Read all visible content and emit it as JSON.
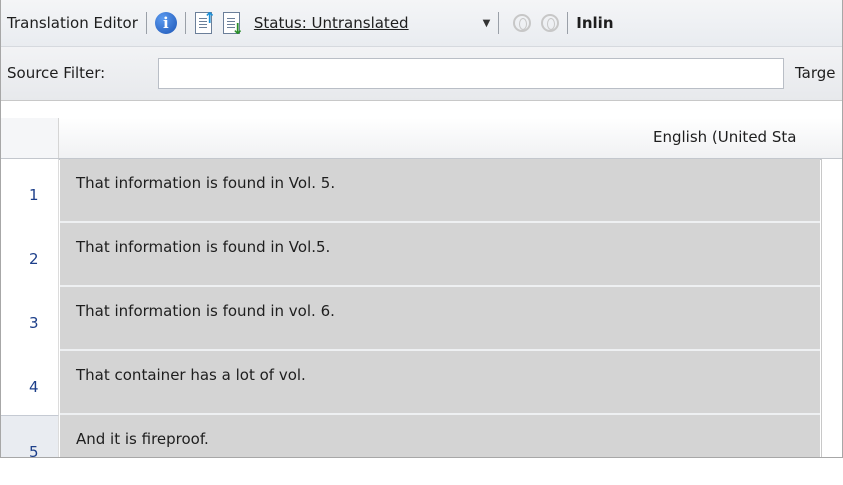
{
  "toolbar": {
    "title": "Translation Editor",
    "status_label": "Status: Untranslated",
    "inline_label": "Inlin",
    "icons": [
      "info-icon",
      "export-document-icon",
      "import-document-icon",
      "dropdown-arrow-icon",
      "toggle-left-icon",
      "toggle-right-icon"
    ]
  },
  "filter": {
    "source_label": "Source Filter:",
    "source_value": "",
    "target_label": "Targe"
  },
  "grid": {
    "column_header": "English (United Sta",
    "rows": [
      {
        "num": "1",
        "text": "That information is found in Vol. 5."
      },
      {
        "num": "2",
        "text": "That information is found in Vol.5."
      },
      {
        "num": "3",
        "text": "That information is found in vol. 6."
      },
      {
        "num": "4",
        "text": "That container has a lot of vol."
      },
      {
        "num": "5",
        "text": "And it is fireproof."
      }
    ],
    "selected_row": "5"
  },
  "colors": {
    "cell_bg": "#d4d4d4",
    "row_number": "#1d3f8a",
    "toolbar_bg": "#eef0f3"
  }
}
